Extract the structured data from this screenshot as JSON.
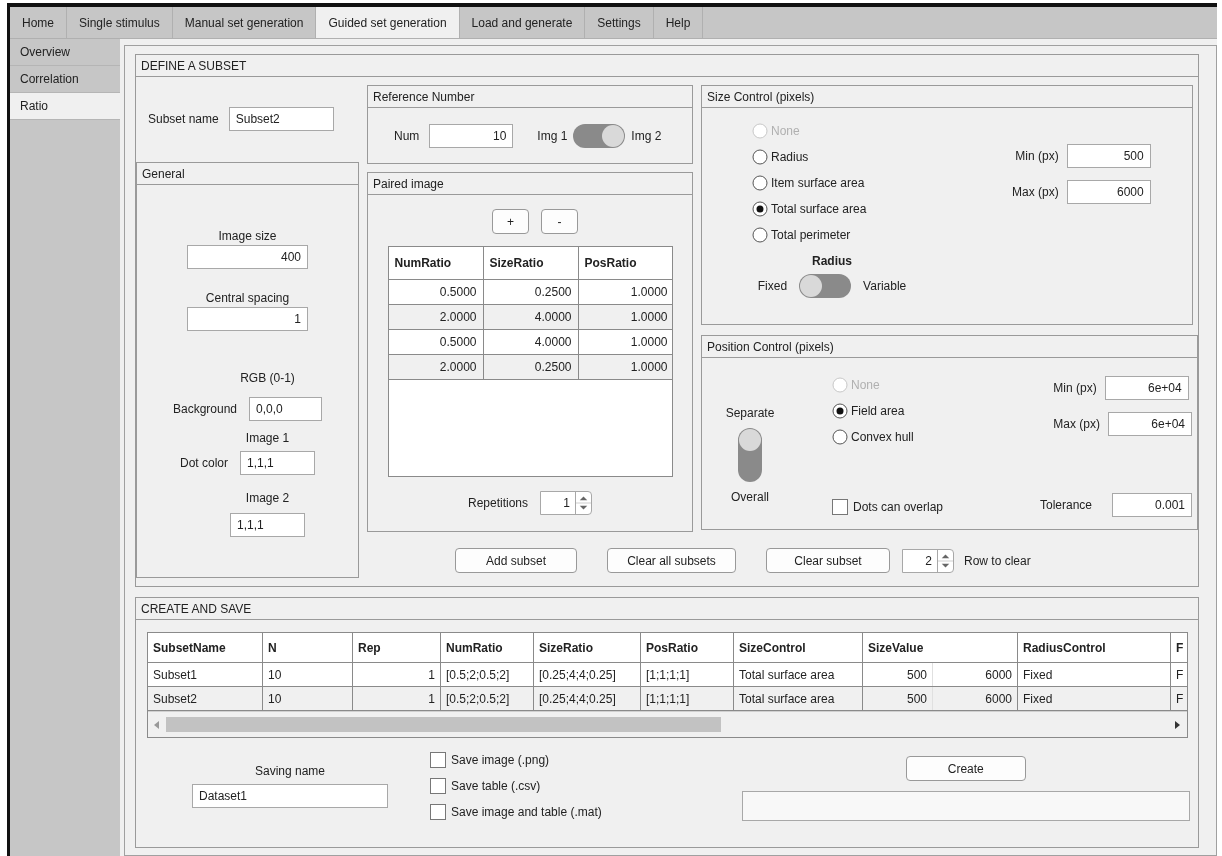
{
  "tabs": [
    {
      "label": "Home",
      "selected": false
    },
    {
      "label": "Single stimulus",
      "selected": false
    },
    {
      "label": "Manual set generation",
      "selected": false
    },
    {
      "label": "Guided set generation",
      "selected": true
    },
    {
      "label": "Load and generate",
      "selected": false
    },
    {
      "label": "Settings",
      "selected": false
    },
    {
      "label": "Help",
      "selected": false
    }
  ],
  "sidebar": {
    "items": [
      {
        "label": "Overview",
        "selected": false
      },
      {
        "label": "Correlation",
        "selected": false
      },
      {
        "label": "Ratio",
        "selected": true
      }
    ]
  },
  "define_panel": {
    "title": "DEFINE A SUBSET",
    "subset_name": {
      "label": "Subset name",
      "value": "Subset2"
    },
    "general": {
      "title": "General",
      "image_size": {
        "label": "Image size",
        "value": "400"
      },
      "central_spacing": {
        "label": "Central spacing",
        "value": "1"
      },
      "rgb_label": "RGB (0-1)",
      "background": {
        "label": "Background",
        "value": "0,0,0"
      },
      "dot_color_label": "Dot color",
      "image_1": {
        "label": "Image 1",
        "value": "1,1,1"
      },
      "image_2": {
        "label": "Image 2",
        "value": "1,1,1"
      }
    },
    "reference_number": {
      "title": "Reference Number",
      "num": {
        "label": "Num",
        "value": "10"
      },
      "image_switch": {
        "left_label": "Img 1",
        "right_label": "Img 2",
        "on": true
      }
    },
    "paired_image": {
      "title": "Paired image",
      "buttons": [
        "+",
        "-"
      ],
      "table": {
        "columns": [
          "NumRatio",
          "SizeRatio",
          "PosRatio"
        ],
        "rows": [
          [
            "0.5000",
            "0.2500",
            "1.0000"
          ],
          [
            "2.0000",
            "4.0000",
            "1.0000"
          ],
          [
            "0.5000",
            "4.0000",
            "1.0000"
          ],
          [
            "2.0000",
            "0.2500",
            "1.0000"
          ]
        ]
      },
      "repetitions": {
        "label": "Repetitions",
        "value": "1"
      }
    },
    "size_control": {
      "title": "Size Control (pixels)",
      "options": [
        {
          "label": "None",
          "selected": false,
          "disabled": true
        },
        {
          "label": "Radius",
          "selected": false,
          "disabled": false
        },
        {
          "label": "Item surface area",
          "selected": false,
          "disabled": false
        },
        {
          "label": "Total surface area",
          "selected": true,
          "disabled": false
        },
        {
          "label": "Total perimeter",
          "selected": false,
          "disabled": false
        }
      ],
      "min": {
        "label": "Min (px)",
        "value": "500"
      },
      "max": {
        "label": "Max (px)",
        "value": "6000"
      },
      "radius_switch": {
        "title": "Radius",
        "left_label": "Fixed",
        "right_label": "Variable",
        "on": false
      }
    },
    "position_control": {
      "title": "Position Control (pixels)",
      "mode_switch": {
        "top_label": "Separate",
        "bottom_label": "Overall",
        "on": false
      },
      "options": [
        {
          "label": "None",
          "selected": false,
          "disabled": true
        },
        {
          "label": "Field area",
          "selected": true,
          "disabled": false
        },
        {
          "label": "Convex hull",
          "selected": false,
          "disabled": false
        }
      ],
      "min": {
        "label": "Min (px)",
        "value": "6e+04"
      },
      "max": {
        "label": "Max (px)",
        "value": "6e+04"
      },
      "overlap": {
        "label": "Dots can overlap",
        "checked": false
      },
      "tolerance": {
        "label": "Tolerance",
        "value": "0.001"
      }
    },
    "actions": {
      "add": "Add subset",
      "clear_all": "Clear all subsets",
      "clear": "Clear subset",
      "row_to_clear": {
        "value": "2",
        "label": "Row to clear"
      }
    }
  },
  "create_panel": {
    "title": "CREATE AND SAVE",
    "table": {
      "columns": [
        "SubsetName",
        "N",
        "Rep",
        "NumRatio",
        "SizeRatio",
        "PosRatio",
        "SizeControl",
        "SizeValue",
        "RadiusControl",
        "F"
      ],
      "rows": [
        [
          "Subset1",
          "10",
          "1",
          "[0.5;2;0.5;2]",
          "[0.25;4;4;0.25]",
          "[1;1;1;1]",
          "Total surface area",
          [
            "500",
            "6000"
          ],
          "Fixed",
          "F"
        ],
        [
          "Subset2",
          "10",
          "1",
          "[0.5;2;0.5;2]",
          "[0.25;4;4;0.25]",
          "[1;1;1;1]",
          "Total surface area",
          [
            "500",
            "6000"
          ],
          "Fixed",
          "F"
        ]
      ]
    },
    "saving_name": {
      "label": "Saving name",
      "value": "Dataset1"
    },
    "save_options": [
      {
        "label": "Save image (.png)",
        "checked": false
      },
      {
        "label": "Save table (.csv)",
        "checked": false
      },
      {
        "label": "Save image and table (.mat)",
        "checked": false
      }
    ],
    "create_button": "Create"
  }
}
